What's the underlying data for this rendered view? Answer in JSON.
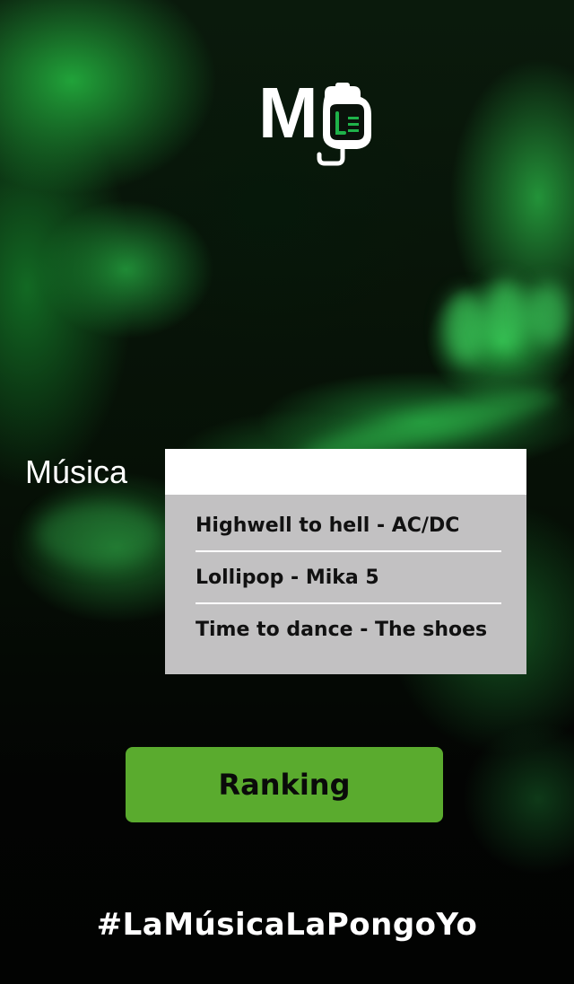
{
  "logo": {
    "letter": "M",
    "mark_icon": "drink-bottle-icon",
    "accent_color": "#1fb24a"
  },
  "search": {
    "label": "Música",
    "value": "",
    "placeholder": ""
  },
  "suggestions": [
    {
      "label": "Highwell to hell - AC/DC"
    },
    {
      "label": "Lollipop - Mika 5"
    },
    {
      "label": "Time to dance - The shoes"
    }
  ],
  "ranking_button": {
    "label": "Ranking",
    "color": "#5aab2e"
  },
  "footer": {
    "hashtag": "#LaMúsicaLaPongoYo"
  }
}
